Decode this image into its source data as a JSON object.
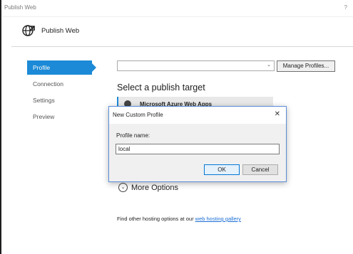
{
  "window": {
    "title": "Publish Web",
    "help": "?"
  },
  "header": {
    "icon": "globe-publish-icon",
    "title": "Publish Web"
  },
  "sidebar": {
    "items": [
      {
        "label": "Profile",
        "active": true
      },
      {
        "label": "Connection",
        "active": false
      },
      {
        "label": "Settings",
        "active": false
      },
      {
        "label": "Preview",
        "active": false
      }
    ]
  },
  "main": {
    "profile_select_value": "",
    "manage_profiles_label": "Manage Profiles...",
    "heading": "Select a publish target",
    "targets": [
      {
        "label": "Microsoft Azure Web Apps",
        "icon": "azure-icon"
      }
    ],
    "more_options_label": "More Options",
    "footer_prefix": "Find other hosting options at our ",
    "footer_link": "web hosting gallery"
  },
  "dialog": {
    "title": "New Custom Profile",
    "profile_name_label": "Profile name:",
    "profile_name_value": "local",
    "ok_label": "OK",
    "cancel_label": "Cancel"
  },
  "colors": {
    "accent": "#1c8ad6",
    "link": "#1c6fd6"
  }
}
